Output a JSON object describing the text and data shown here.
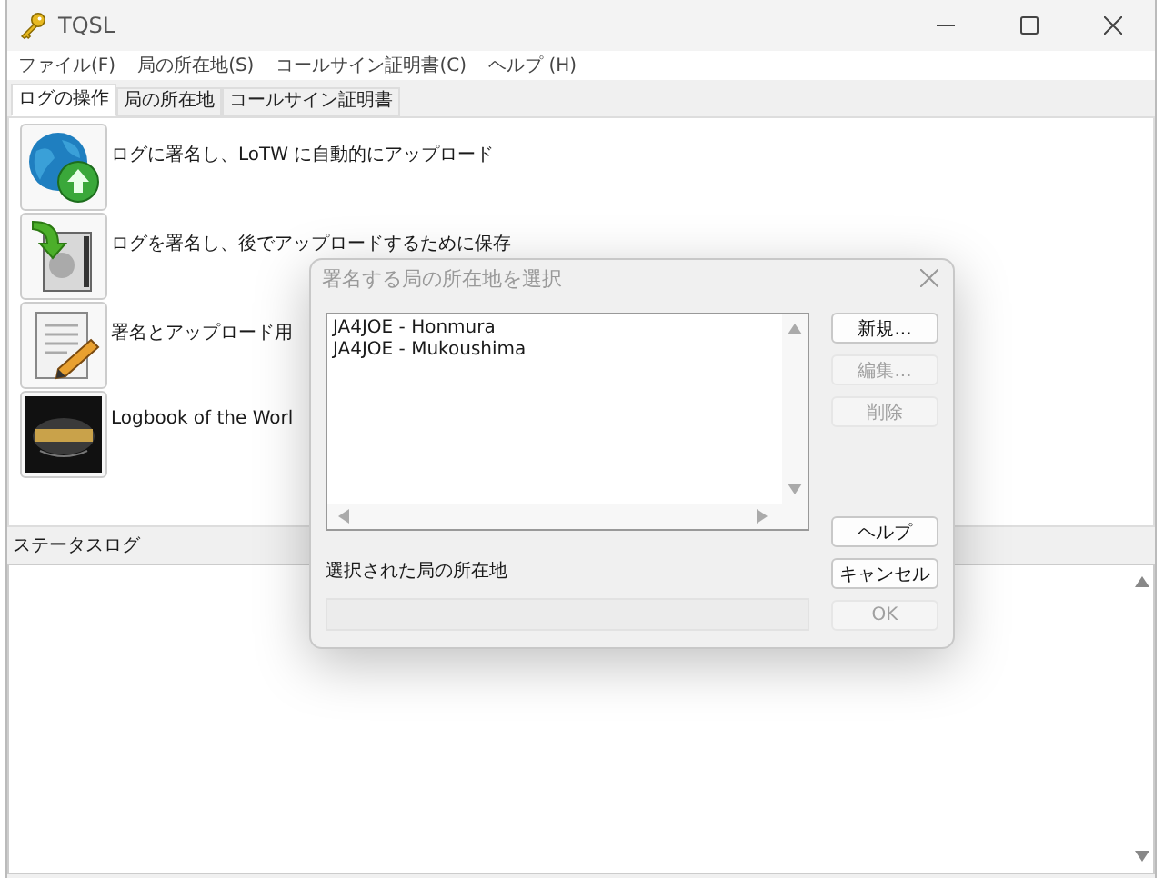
{
  "window": {
    "title": "TQSL"
  },
  "menu": [
    "ファイル(F)",
    "局の所在地(S)",
    "コールサイン証明書(C)",
    "ヘルプ (H)"
  ],
  "tabs": [
    {
      "label": "ログの操作",
      "selected": true
    },
    {
      "label": "局の所在地",
      "selected": false
    },
    {
      "label": "コールサイン証明書",
      "selected": false
    }
  ],
  "actions": [
    {
      "kind": "globe",
      "label": "ログに署名し、LoTW に自動的にアップロード"
    },
    {
      "kind": "drive",
      "label": "ログを署名し、後でアップロードするために保存"
    },
    {
      "kind": "notepad",
      "label": "署名とアップロード用"
    },
    {
      "kind": "logo",
      "label": "Logbook of the Worl"
    }
  ],
  "status_log": {
    "label": "ステータスログ"
  },
  "dialog": {
    "title": "署名する局の所在地を選択",
    "locations": [
      "JA4JOE - Honmura",
      "JA4JOE - Mukoushima"
    ],
    "side_buttons": [
      {
        "label": "新規...",
        "disabled": false
      },
      {
        "label": "編集...",
        "disabled": true
      },
      {
        "label": "削除",
        "disabled": true
      }
    ],
    "selected_label": "選択された局の所在地",
    "bottom_buttons": [
      {
        "label": "ヘルプ",
        "disabled": false
      },
      {
        "label": "キャンセル",
        "disabled": false
      },
      {
        "label": "OK",
        "disabled": true
      }
    ]
  }
}
